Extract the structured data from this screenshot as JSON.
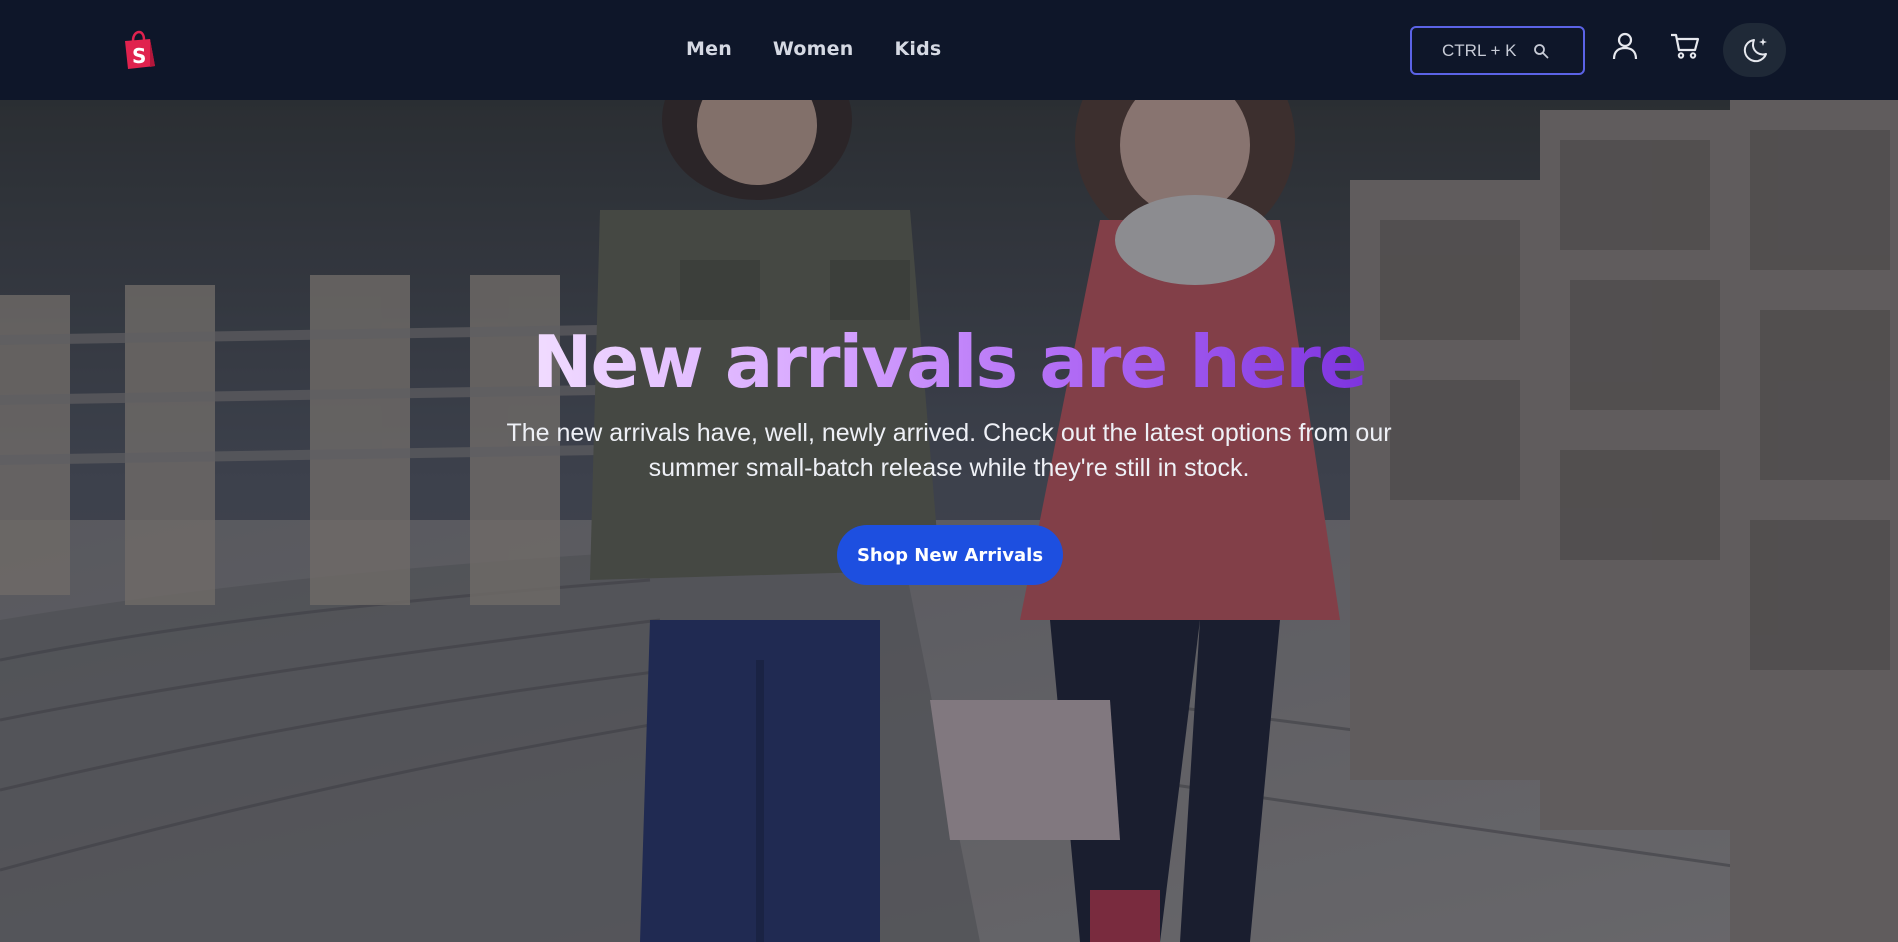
{
  "header": {
    "logo_icon": "shopping-bag-logo",
    "nav": [
      {
        "label": "Men"
      },
      {
        "label": "Women"
      },
      {
        "label": "Kids"
      }
    ],
    "search": {
      "shortcut_label": "CTRL + K",
      "icon": "search-icon"
    },
    "account_icon": "user-icon",
    "cart_icon": "cart-icon",
    "theme_icon": "moon-sparkle-icon"
  },
  "hero": {
    "title": "New arrivals are here",
    "subtitle": "The new arrivals have, well, newly arrived. Check out the latest options from our summer small-batch release while they're still in stock.",
    "cta_label": "Shop New Arrivals"
  },
  "colors": {
    "header_bg": "#0e1629",
    "accent": "#5b63e6",
    "cta": "#1d4fe0",
    "logo": "#e0224e",
    "title_gradient": [
      "#f1dcff",
      "#d7a6ff",
      "#b06af5",
      "#7d33de"
    ]
  }
}
